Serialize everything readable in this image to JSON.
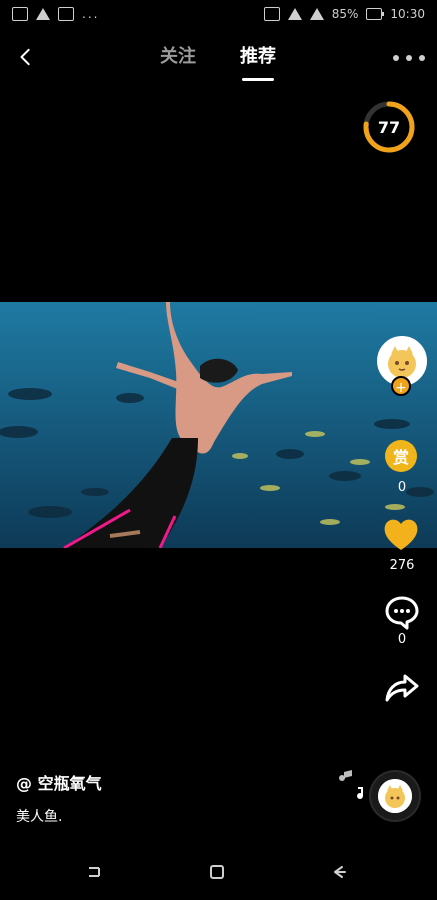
{
  "status": {
    "battery_text": "85%",
    "time": "10:30"
  },
  "topnav": {
    "tabs": [
      {
        "label": "关注",
        "active": false
      },
      {
        "label": "推荐",
        "active": true
      }
    ]
  },
  "timer": {
    "value": "77",
    "progress_fraction": 0.77,
    "ring_color": "#F0A21B"
  },
  "rail": {
    "reward_label": "赏",
    "reward_count": "0",
    "likes": "276",
    "comments": "0"
  },
  "post": {
    "author": "@ 空瓶氧气",
    "caption": "美人鱼."
  },
  "icons": {
    "back": "chevron-left-icon",
    "more": "more-dots-icon",
    "heart": "heart-icon",
    "comment": "comment-icon",
    "share": "share-icon",
    "music": "music-note-icon"
  },
  "colors": {
    "accent": "#F0A21B",
    "heart": "#F3B21C",
    "video_bg": "#1B5F86"
  }
}
